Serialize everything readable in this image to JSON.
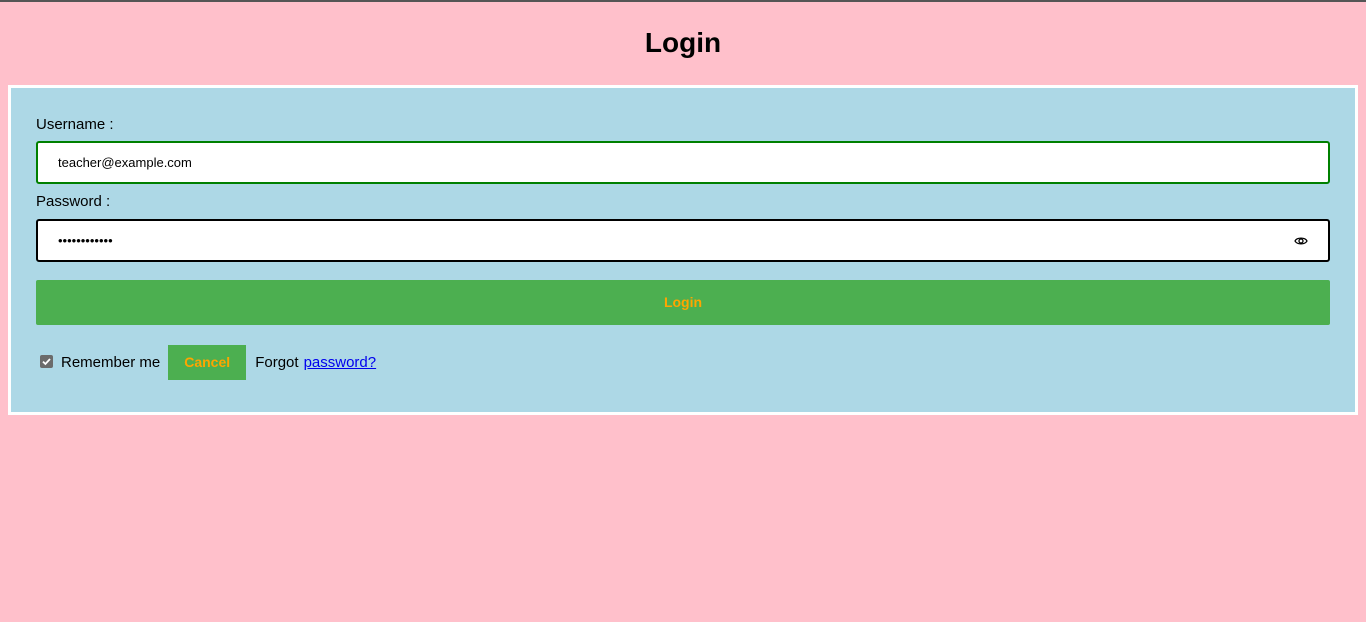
{
  "header": {
    "title": "Login"
  },
  "form": {
    "username_label": "Username :",
    "username_value": "teacher@example.com",
    "password_label": "Password :",
    "password_value": "••••••••••••",
    "password_toggle_icon": "eye-icon",
    "login_button_label": "Login",
    "remember_label": "Remember me",
    "remember_checked": true,
    "cancel_button_label": "Cancel",
    "forgot_text": "Forgot",
    "forgot_link_label": "password?"
  },
  "colors": {
    "page_background": "#ffc0cb",
    "panel_background": "#add8e6",
    "button_background": "#4caf50",
    "button_text": "#ffa500",
    "username_border": "#008000",
    "link": "#0000ee"
  }
}
